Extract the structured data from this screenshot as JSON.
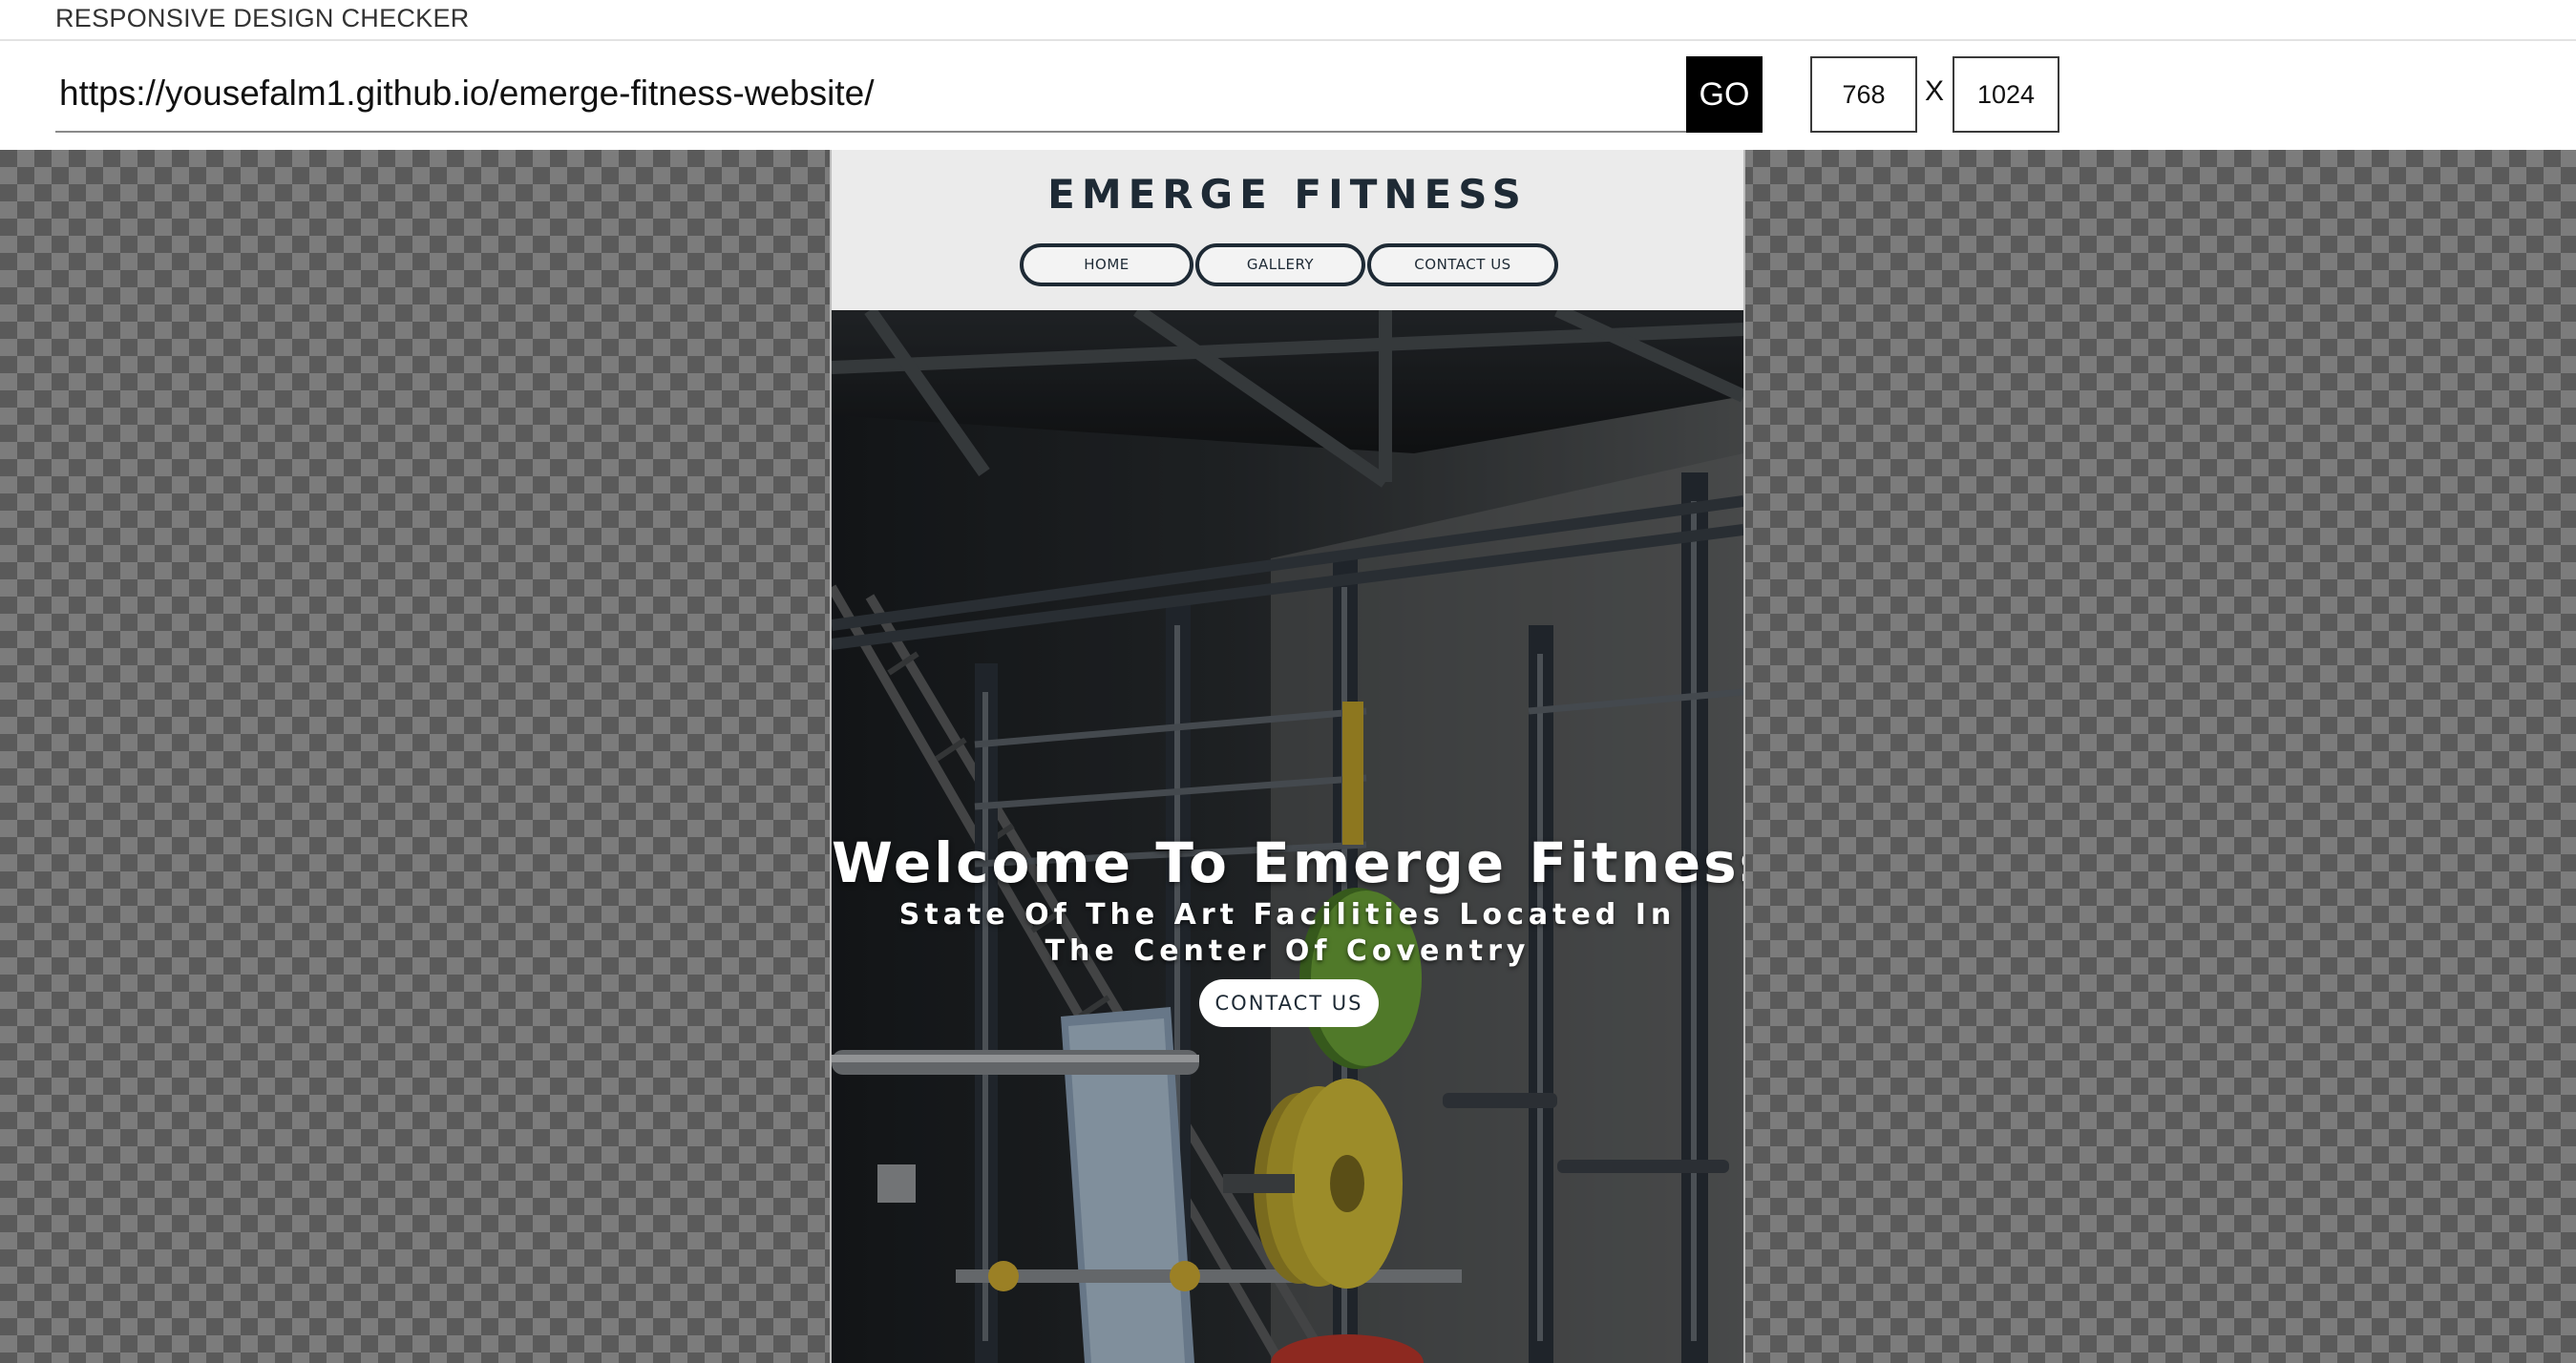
{
  "app": {
    "title": "RESPONSIVE DESIGN CHECKER"
  },
  "toolbar": {
    "url_value": "https://yousefalm1.github.io/emerge-fitness-website/",
    "go_label": "GO",
    "width_value": "768",
    "separator": "X",
    "height_value": "1024"
  },
  "site": {
    "logo": "EMERGE FITNESS",
    "nav": [
      {
        "label": "HOME"
      },
      {
        "label": "GALLERY"
      },
      {
        "label": "CONTACT US"
      }
    ],
    "hero": {
      "title": "Welcome To Emerge Fitness",
      "subtitle": "State Of The Art Facilities Located In The Center Of Coventry",
      "cta_label": "CONTACT US"
    }
  },
  "colors": {
    "brand_dark": "#1e2a35",
    "go_button": "#000000",
    "checker_dark": "#5a5a5a",
    "checker_light": "#7c7c7c",
    "plate_green": "#6fa83a",
    "plate_yellow": "#d8c23a",
    "plate_red": "#c4392d"
  }
}
